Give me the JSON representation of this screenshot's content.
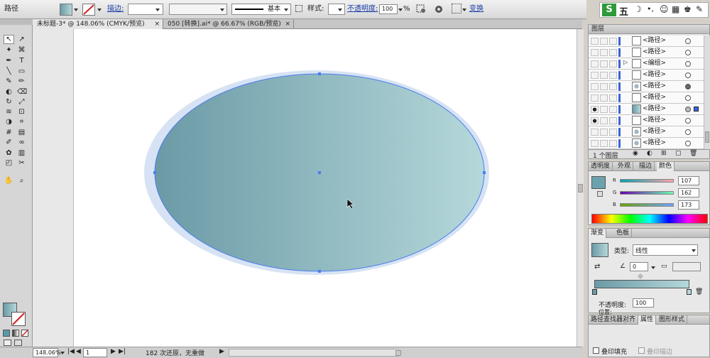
{
  "control_bar": {
    "object_type": "路径",
    "stroke_label": "描边:",
    "stroke_profile": "基本",
    "style_label": "样式:",
    "opacity_label": "不透明度:",
    "opacity_value": "100",
    "opacity_unit": "%",
    "transform_label": "变换"
  },
  "tabs": [
    {
      "label": "未标题-3* @ 148.06% (CMYK/预览)",
      "close": "×"
    },
    {
      "label": "050 [转换].ai* @ 66.67% (RGB/预览)",
      "close": "×"
    }
  ],
  "status_bar": {
    "zoom": "148.06%",
    "artboard": "1",
    "undo_text": "182 次还原，无重做"
  },
  "layers_panel": {
    "title": "图层",
    "items": [
      {
        "label": "<路径>",
        "visible": false,
        "expand": false,
        "selected": false
      },
      {
        "label": "<路径>",
        "visible": false,
        "expand": false,
        "selected": false
      },
      {
        "label": "<编组>",
        "visible": false,
        "expand": true,
        "selected": false
      },
      {
        "label": "<路径>",
        "visible": false,
        "expand": false,
        "selected": false
      },
      {
        "label": "<路径>",
        "visible": false,
        "expand": false,
        "selected": false
      },
      {
        "label": "<路径>",
        "visible": false,
        "expand": false,
        "selected": false
      },
      {
        "label": "<路径>",
        "visible": true,
        "expand": false,
        "selected": true
      },
      {
        "label": "<路径>",
        "visible": true,
        "expand": false,
        "selected": false
      },
      {
        "label": "<路径>",
        "visible": false,
        "expand": false,
        "selected": false
      },
      {
        "label": "<路径>",
        "visible": false,
        "expand": false,
        "selected": false
      }
    ],
    "footer": "1 个图层"
  },
  "color_panel": {
    "tabs": [
      "透明度",
      "外观",
      "描边",
      "颜色"
    ],
    "active_tab": "颜色",
    "r_label": "R",
    "r_value": "107",
    "g_label": "G",
    "g_value": "162",
    "b_label": "B",
    "b_value": "173",
    "swatch_color": "#6ba2ad"
  },
  "gradient_panel": {
    "tabs": [
      "渐变",
      "色板"
    ],
    "type_label": "类型:",
    "type_value": "线性",
    "angle_value": "0",
    "opacity_label": "不透明度:",
    "opacity_value": "100",
    "location_label": "位置:"
  },
  "bottom_panel": {
    "tabs": [
      "路径查找器",
      "对齐",
      "属性",
      "图形样式"
    ],
    "overprint_fill": "叠印填充",
    "overprint_stroke": "叠印描边"
  },
  "ime_bar": {
    "logo": "S",
    "mode": "五"
  },
  "colors": {
    "gradient_start": "#6b9aa6",
    "gradient_end": "#b5d8da",
    "selection": "#4a7cf0"
  }
}
